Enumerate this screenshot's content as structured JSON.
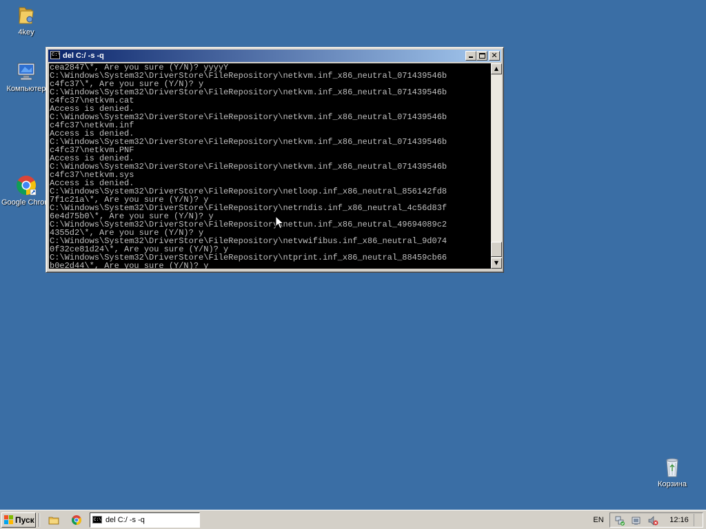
{
  "desktop": {
    "background": "#3a6ea5",
    "icons": [
      {
        "label": "4key",
        "icon": "folder-icon"
      },
      {
        "label": "Компьютер",
        "icon": "computer-icon"
      },
      {
        "label": "Google Chrome",
        "icon": "chrome-icon"
      },
      {
        "label": "Корзина",
        "icon": "recycle-bin-icon"
      }
    ]
  },
  "window": {
    "title": "del  C:/ -s -q",
    "app_icon_text": "C:\\",
    "buttons": {
      "minimize": "minimize-icon",
      "maximize": "maximize-icon",
      "close": "close-icon"
    },
    "console_text": "cea2847\\*, Are you sure (Y/N)? yyyyY\nC:\\Windows\\System32\\DriverStore\\FileRepository\\netkvm.inf_x86_neutral_071439546b\nc4fc37\\*, Are you sure (Y/N)? y\nC:\\Windows\\System32\\DriverStore\\FileRepository\\netkvm.inf_x86_neutral_071439546b\nc4fc37\\netkvm.cat\nAccess is denied.\nC:\\Windows\\System32\\DriverStore\\FileRepository\\netkvm.inf_x86_neutral_071439546b\nc4fc37\\netkvm.inf\nAccess is denied.\nC:\\Windows\\System32\\DriverStore\\FileRepository\\netkvm.inf_x86_neutral_071439546b\nc4fc37\\netkvm.PNF\nAccess is denied.\nC:\\Windows\\System32\\DriverStore\\FileRepository\\netkvm.inf_x86_neutral_071439546b\nc4fc37\\netkvm.sys\nAccess is denied.\nC:\\Windows\\System32\\DriverStore\\FileRepository\\netloop.inf_x86_neutral_856142fd8\n7f1c21a\\*, Are you sure (Y/N)? y\nC:\\Windows\\System32\\DriverStore\\FileRepository\\netrndis.inf_x86_neutral_4c56d83f\n6e4d75b0\\*, Are you sure (Y/N)? y\nC:\\Windows\\System32\\DriverStore\\FileRepository\\nettun.inf_x86_neutral_49694089c2\n4355d2\\*, Are you sure (Y/N)? y\nC:\\Windows\\System32\\DriverStore\\FileRepository\\netvwifibus.inf_x86_neutral_9d074\n0f32ce81d24\\*, Are you sure (Y/N)? y\nC:\\Windows\\System32\\DriverStore\\FileRepository\\ntprint.inf_x86_neutral_88459cb66\nb0e2d44\\*, Are you sure (Y/N)? y",
    "scrollbar": {
      "up": "▲",
      "down": "▼"
    }
  },
  "taskbar": {
    "start_label": "Пуск",
    "quicklaunch": [
      "explorer-icon",
      "chrome-icon"
    ],
    "tasks": [
      {
        "label": "del  C:/ -s -q",
        "icon_text": "C:\\"
      }
    ],
    "language": "EN",
    "tray_icons": [
      "network-icon",
      "action-center-icon",
      "volume-muted-icon"
    ],
    "clock": "12:16"
  },
  "colors": {
    "title_start": "#0a246a",
    "title_end": "#a6caf0",
    "console_bg": "#000000",
    "console_fg": "#c0c0c0",
    "taskbar": "#d4d0c8"
  }
}
